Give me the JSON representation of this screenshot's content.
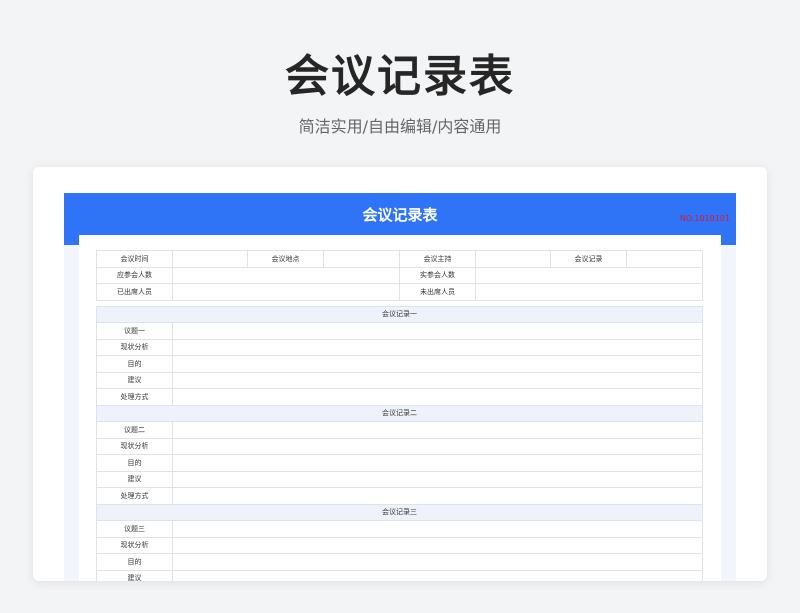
{
  "hero": {
    "title": "会议记录表",
    "subtitle": "简洁实用/自由编辑/内容通用"
  },
  "doc": {
    "title": "会议记录表",
    "number": "NO.1010101"
  },
  "info": {
    "row1": [
      "会议时间",
      "会议地点",
      "会议主持",
      "会议记录"
    ],
    "row2": [
      "应参会人数",
      "实参会人数"
    ],
    "row3": [
      "已出席人员",
      "未出席人员"
    ]
  },
  "sections": [
    {
      "title": "会议记录一",
      "rows": [
        "议题一",
        "现状分析",
        "目的",
        "建议",
        "处理方式"
      ]
    },
    {
      "title": "会议记录二",
      "rows": [
        "议题二",
        "现状分析",
        "目的",
        "建议",
        "处理方式"
      ]
    },
    {
      "title": "会议记录三",
      "rows": [
        "议题三",
        "现状分析",
        "目的",
        "建议"
      ]
    }
  ],
  "colors": {
    "header": "#2f74f6",
    "number": "#e0142d",
    "section_bg": "#eef3fb"
  }
}
